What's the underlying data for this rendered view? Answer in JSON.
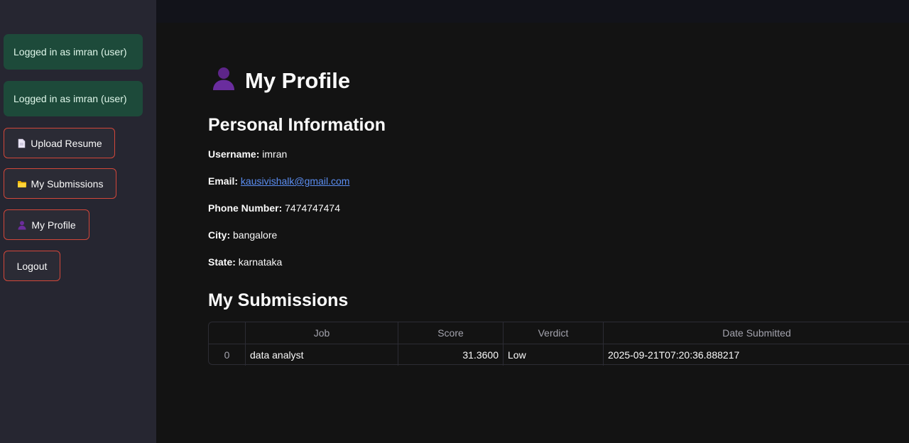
{
  "sidebar": {
    "alerts": [
      "Logged in as imran (user)",
      "Logged in as imran (user)"
    ],
    "buttons": [
      {
        "label": "Upload Resume",
        "icon": "document-icon"
      },
      {
        "label": "My Submissions",
        "icon": "folder-icon"
      },
      {
        "label": "My Profile",
        "icon": "person-icon"
      },
      {
        "label": "Logout",
        "icon": ""
      }
    ]
  },
  "main": {
    "title": "My Profile",
    "title_icon": "person-icon",
    "personal_heading": "Personal Information",
    "fields": {
      "username": {
        "label": "Username:",
        "value": "imran"
      },
      "email": {
        "label": "Email:",
        "value": "kausivishalk@gmail.com"
      },
      "phone": {
        "label": "Phone Number:",
        "value": "7474747474"
      },
      "city": {
        "label": "City:",
        "value": "bangalore"
      },
      "state": {
        "label": "State:",
        "value": "karnataka"
      }
    },
    "submissions_heading": "My Submissions",
    "table": {
      "headers": [
        "",
        "Job",
        "Score",
        "Verdict",
        "Date Submitted"
      ],
      "rows": [
        [
          "0",
          "data analyst",
          "31.3600",
          "Low",
          "2025-09-21T07:20:36.888217"
        ]
      ]
    }
  },
  "colors": {
    "sidebar_bg": "#262631",
    "main_bg": "#131313",
    "alert_bg": "#1d4a3a",
    "button_border": "#d2473a",
    "link": "#5b8ef2"
  }
}
